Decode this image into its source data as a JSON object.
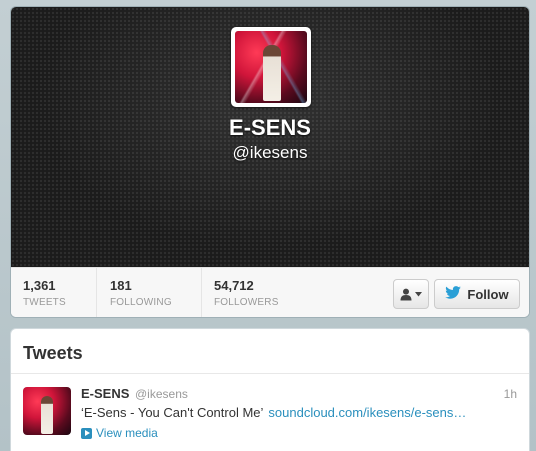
{
  "profile": {
    "display_name": "E-SENS",
    "screen_name": "@ikesens",
    "avatar_icon": "profile-photo"
  },
  "stats": [
    {
      "value": "1,361",
      "label": "TWEETS"
    },
    {
      "value": "181",
      "label": "FOLLOWING"
    },
    {
      "value": "54,712",
      "label": "FOLLOWERS"
    }
  ],
  "actions": {
    "user_menu_icon": "person-icon",
    "follow_label": "Follow",
    "follow_icon": "twitter-bird-icon"
  },
  "tweets": {
    "heading": "Tweets",
    "items": [
      {
        "name": "E-SENS",
        "handle": "@ikesens",
        "time": "1h",
        "text": "‘E-Sens - You Can't Control Me’",
        "link": "soundcloud.com/ikesens/e-sens…",
        "media_label": "View media"
      }
    ]
  },
  "colors": {
    "link": "#2a8fbd",
    "header_bg": "#1b1b1b",
    "page_bg": "#b9c7cc"
  }
}
